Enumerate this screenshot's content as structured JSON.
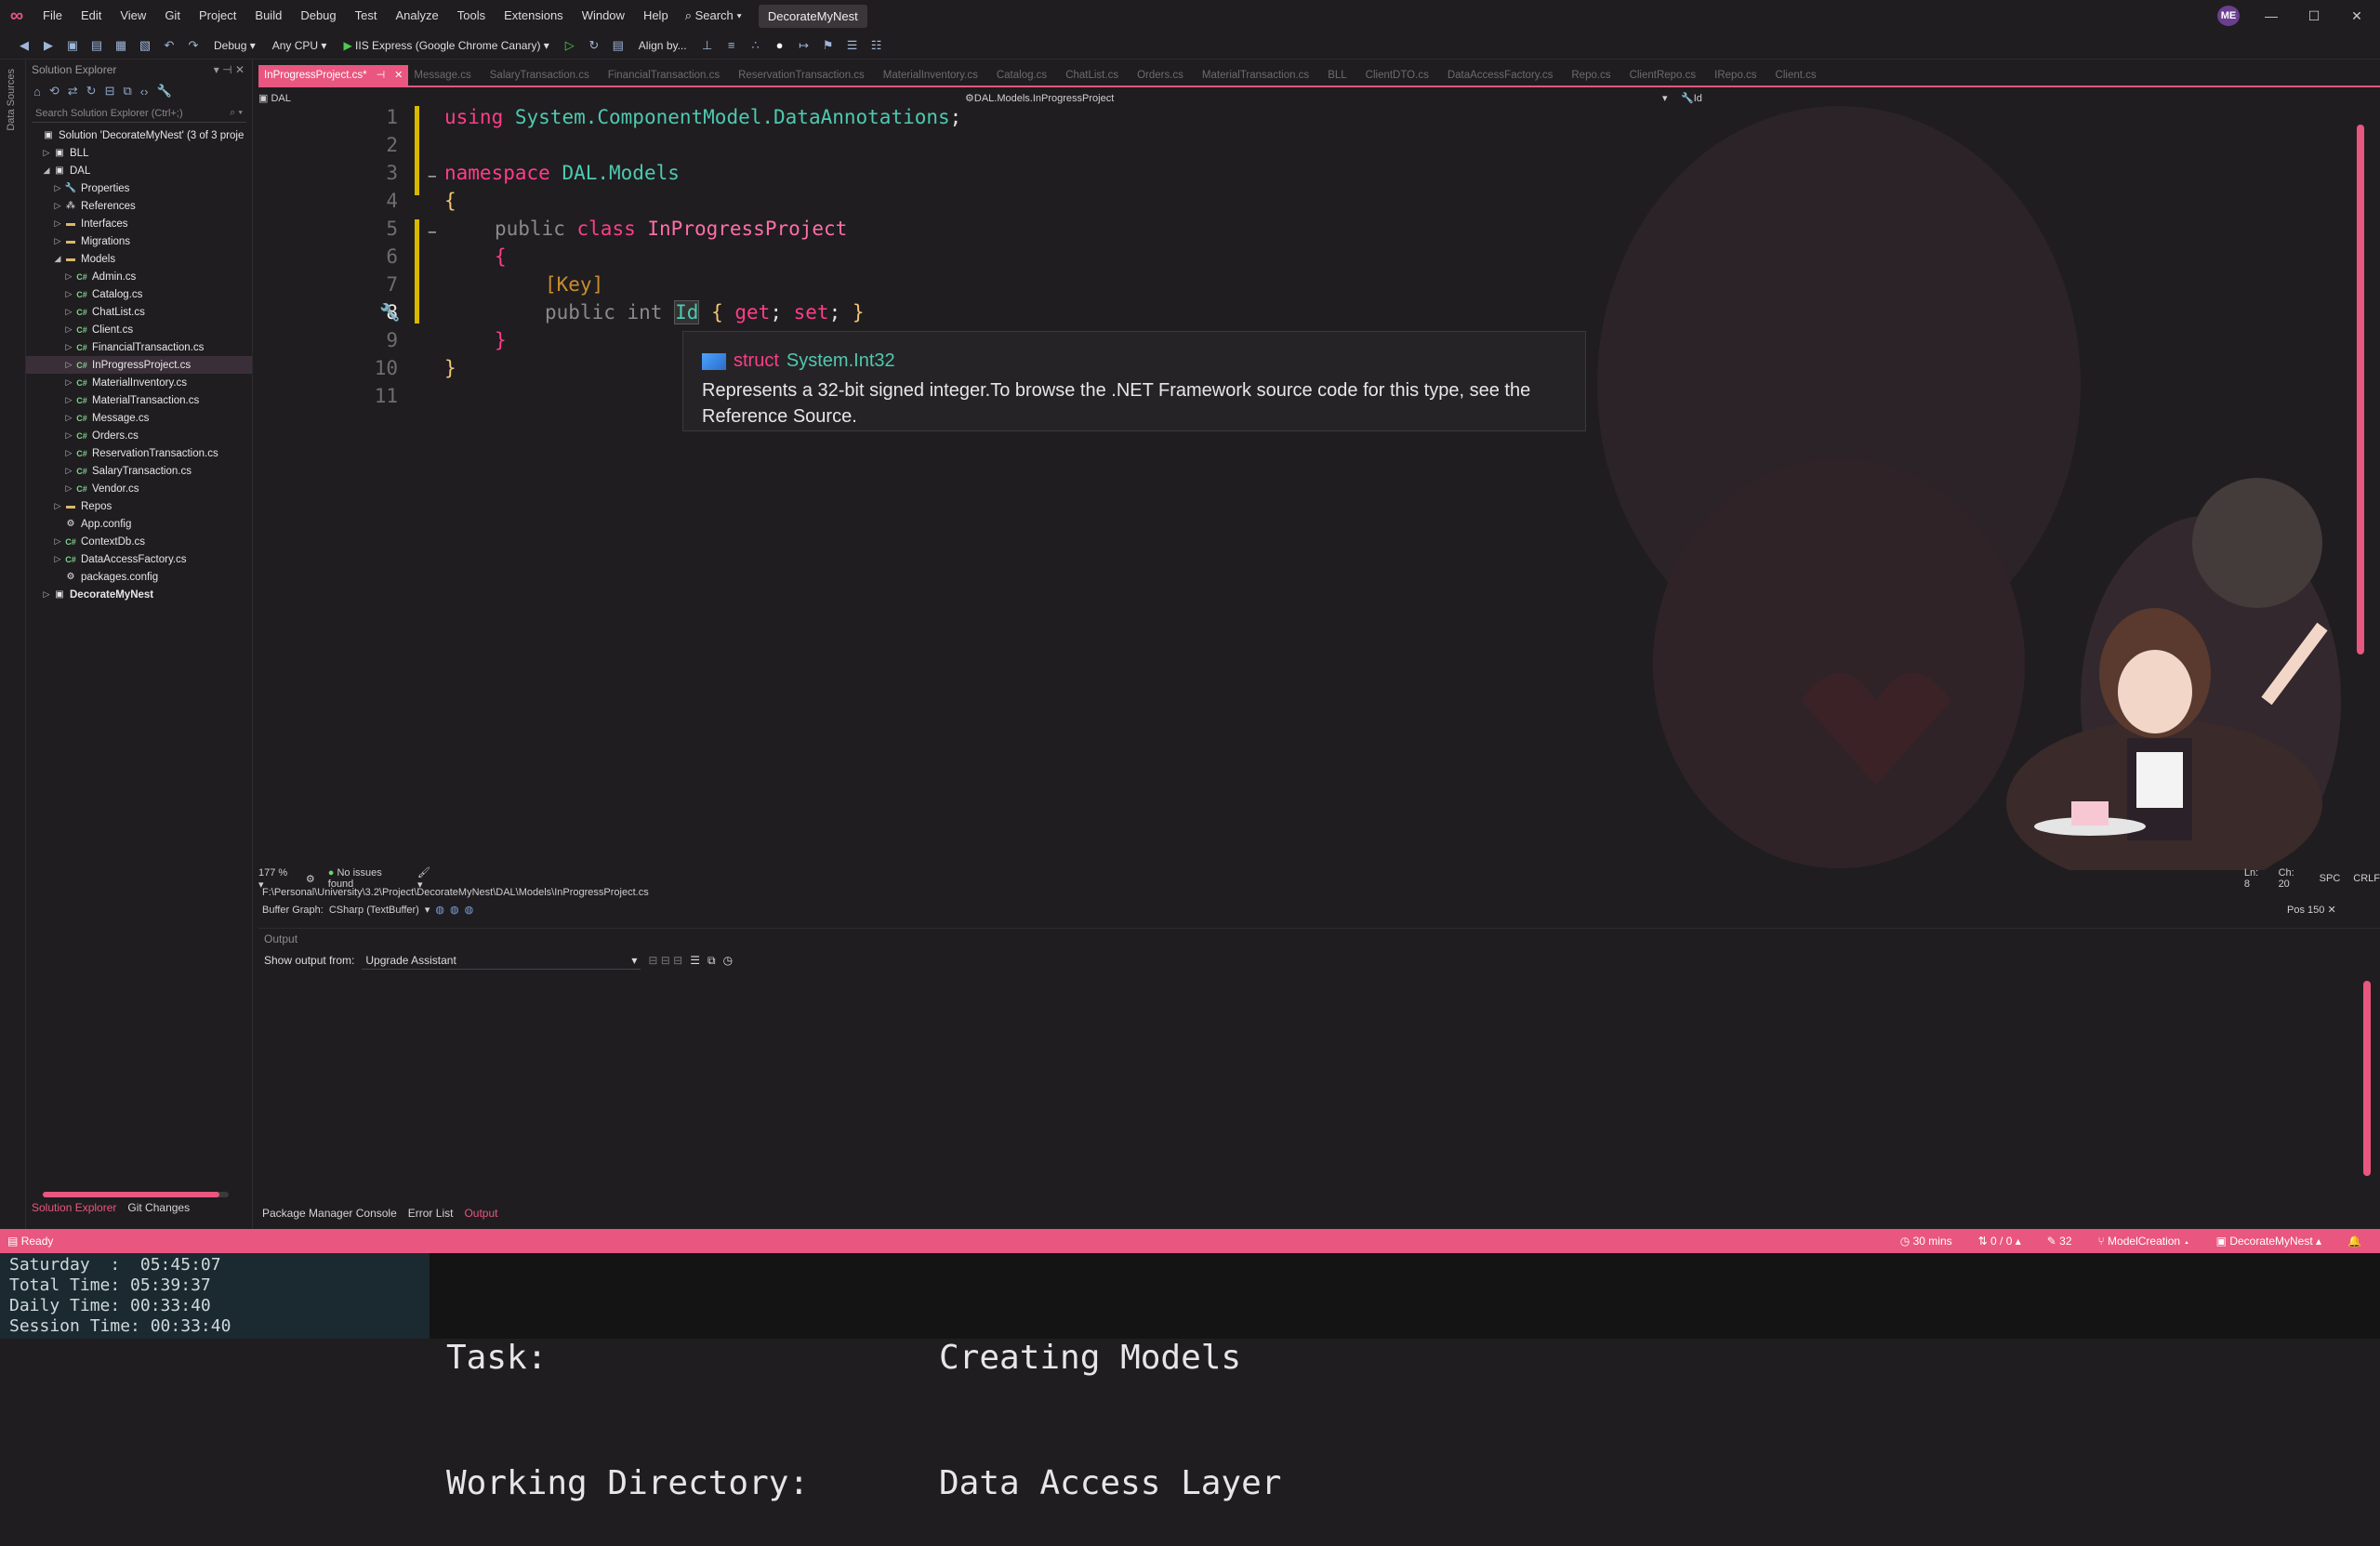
{
  "titlebar": {
    "menu": [
      "File",
      "Edit",
      "View",
      "Git",
      "Project",
      "Build",
      "Debug",
      "Test",
      "Analyze",
      "Tools",
      "Extensions",
      "Window",
      "Help"
    ],
    "search_label": "Search",
    "solution_name": "DecorateMyNest",
    "avatar_initials": "ME"
  },
  "toolbar": {
    "config": "Debug",
    "platform": "Any CPU",
    "run_target": "IIS Express (Google Chrome Canary)",
    "align_label": "Align by..."
  },
  "side_strip_label": "Data Sources",
  "solution_explorer": {
    "title": "Solution Explorer",
    "search_placeholder": "Search Solution Explorer (Ctrl+;)",
    "nodes": [
      {
        "label": "Solution 'DecorateMyNest' (3 of 3 proje",
        "indent": 0,
        "arrow": "",
        "kind": "solution"
      },
      {
        "label": "BLL",
        "indent": 1,
        "arrow": "▷",
        "kind": "project"
      },
      {
        "label": "DAL",
        "indent": 1,
        "arrow": "◢",
        "kind": "project"
      },
      {
        "label": "Properties",
        "indent": 2,
        "arrow": "▷",
        "kind": "props"
      },
      {
        "label": "References",
        "indent": 2,
        "arrow": "▷",
        "kind": "refs"
      },
      {
        "label": "Interfaces",
        "indent": 2,
        "arrow": "▷",
        "kind": "folder"
      },
      {
        "label": "Migrations",
        "indent": 2,
        "arrow": "▷",
        "kind": "folder"
      },
      {
        "label": "Models",
        "indent": 2,
        "arrow": "◢",
        "kind": "folder"
      },
      {
        "label": "Admin.cs",
        "indent": 3,
        "arrow": "▷",
        "kind": "cs"
      },
      {
        "label": "Catalog.cs",
        "indent": 3,
        "arrow": "▷",
        "kind": "cs"
      },
      {
        "label": "ChatList.cs",
        "indent": 3,
        "arrow": "▷",
        "kind": "cs"
      },
      {
        "label": "Client.cs",
        "indent": 3,
        "arrow": "▷",
        "kind": "cs"
      },
      {
        "label": "FinancialTransaction.cs",
        "indent": 3,
        "arrow": "▷",
        "kind": "cs"
      },
      {
        "label": "InProgressProject.cs",
        "indent": 3,
        "arrow": "▷",
        "kind": "cs",
        "selected": true
      },
      {
        "label": "MaterialInventory.cs",
        "indent": 3,
        "arrow": "▷",
        "kind": "cs"
      },
      {
        "label": "MaterialTransaction.cs",
        "indent": 3,
        "arrow": "▷",
        "kind": "cs"
      },
      {
        "label": "Message.cs",
        "indent": 3,
        "arrow": "▷",
        "kind": "cs"
      },
      {
        "label": "Orders.cs",
        "indent": 3,
        "arrow": "▷",
        "kind": "cs"
      },
      {
        "label": "ReservationTransaction.cs",
        "indent": 3,
        "arrow": "▷",
        "kind": "cs"
      },
      {
        "label": "SalaryTransaction.cs",
        "indent": 3,
        "arrow": "▷",
        "kind": "cs"
      },
      {
        "label": "Vendor.cs",
        "indent": 3,
        "arrow": "▷",
        "kind": "cs"
      },
      {
        "label": "Repos",
        "indent": 2,
        "arrow": "▷",
        "kind": "folder"
      },
      {
        "label": "App.config",
        "indent": 2,
        "arrow": "",
        "kind": "config"
      },
      {
        "label": "ContextDb.cs",
        "indent": 2,
        "arrow": "▷",
        "kind": "cs"
      },
      {
        "label": "DataAccessFactory.cs",
        "indent": 2,
        "arrow": "▷",
        "kind": "cs"
      },
      {
        "label": "packages.config",
        "indent": 2,
        "arrow": "",
        "kind": "config"
      },
      {
        "label": "DecorateMyNest",
        "indent": 1,
        "arrow": "▷",
        "kind": "project-bold"
      }
    ],
    "bottom_tabs": [
      "Solution Explorer",
      "Git Changes"
    ]
  },
  "tabs": [
    {
      "label": "InProgressProject.cs*",
      "active": true
    },
    {
      "label": "Message.cs"
    },
    {
      "label": "SalaryTransaction.cs"
    },
    {
      "label": "FinancialTransaction.cs"
    },
    {
      "label": "ReservationTransaction.cs"
    },
    {
      "label": "MaterialInventory.cs"
    },
    {
      "label": "Catalog.cs"
    },
    {
      "label": "ChatList.cs"
    },
    {
      "label": "Orders.cs"
    },
    {
      "label": "MaterialTransaction.cs"
    },
    {
      "label": "BLL"
    },
    {
      "label": "ClientDTO.cs"
    },
    {
      "label": "DataAccessFactory.cs"
    },
    {
      "label": "Repo.cs"
    },
    {
      "label": "ClientRepo.cs"
    },
    {
      "label": "IRepo.cs"
    },
    {
      "label": "Client.cs"
    }
  ],
  "navbar": {
    "project": "DAL",
    "type": "DAL.Models.InProgressProject",
    "member": "Id"
  },
  "editor": {
    "line_numbers": [
      "1",
      "2",
      "3",
      "4",
      "5",
      "6",
      "7",
      "8",
      "9",
      "10",
      "11"
    ],
    "current_line": "8",
    "tokens": {
      "l1_using": "using",
      "l1_ns": "System.ComponentModel.DataAnnotations",
      "l1_semi": ";",
      "l3_ns_kw": "namespace",
      "l3_ns": "DAL.Models",
      "brace_open": "{",
      "brace_close": "}",
      "l5_public": "public",
      "l5_class": "class",
      "l5_name": "InProgressProject",
      "l7_attr": "[Key]",
      "l8_public": "public",
      "l8_int": "int",
      "l8_id": "Id",
      "l8_get": "get",
      "l8_set": "set",
      "semi": ";"
    }
  },
  "tooltip": {
    "keyword": "struct",
    "type_name": "System.Int32",
    "description": "Represents a 32-bit signed integer.To browse the .NET Framework source code for this type, see the Reference Source."
  },
  "editor_status": {
    "zoom": "177 %",
    "issues": "No issues found",
    "line": "Ln: 8",
    "col": "Ch: 20",
    "spacing": "SPC",
    "eol": "CRLF",
    "path": "F:\\Personal\\University\\3.2\\Project\\DecorateMyNest\\DAL\\Models\\InProgressProject.cs",
    "buffer_graph_label": "Buffer Graph:",
    "buffer_graph_value": "CSharp (TextBuffer)",
    "pos": "Pos 150"
  },
  "output": {
    "title": "Output",
    "show_from_label": "Show output from:",
    "show_from_value": "Upgrade Assistant",
    "bottom_tabs": [
      "Package Manager Console",
      "Error List",
      "Output"
    ]
  },
  "statusbar": {
    "ready": "Ready",
    "time": "30 mins",
    "sync": "0 / 0",
    "edits": "32",
    "branch": "ModelCreation",
    "repo": "DecorateMyNest"
  },
  "terminal": {
    "left_lines": [
      "Saturday  :  05:45:07",
      "Total Time: 05:39:37",
      "Daily Time: 00:33:40",
      "Session Time: 00:33:40"
    ],
    "task_label": "Task:",
    "task_value": "Creating Models",
    "dir_label": "Working Directory:",
    "dir_value": "Data Access Layer"
  },
  "colors": {
    "accent": "#e9567f",
    "background": "#1f1d20",
    "keyword": "#ff3d89",
    "type": "#4ec9b0"
  }
}
